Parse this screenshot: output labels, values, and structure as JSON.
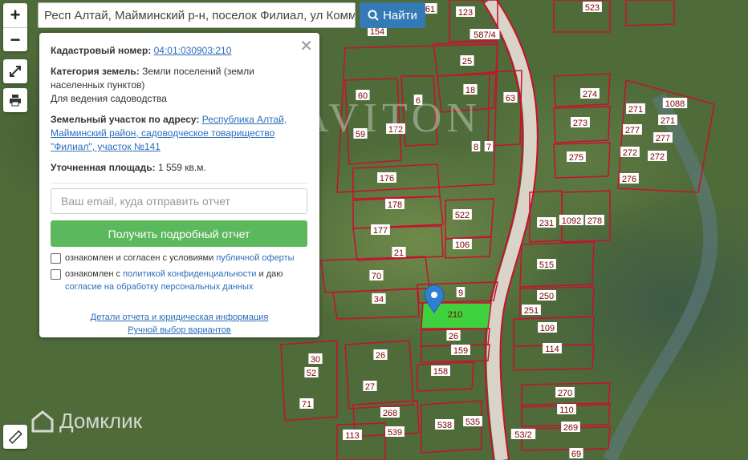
{
  "search": {
    "value": "Респ Алтай, Майминский р-н, поселок Филиал, ул Коммуна",
    "button_label": "Найти",
    "icon": "search-icon"
  },
  "map": {
    "watermark": "GRAVITON",
    "brand": "Домклик",
    "selected_plot": "210",
    "plot_labels": [
      "61",
      "123",
      "523",
      "154",
      "587/4",
      "25",
      "18",
      "60",
      "6",
      "63",
      "274",
      "1088",
      "271",
      "271",
      "273",
      "277",
      "277",
      "172",
      "59",
      "275",
      "272",
      "272",
      "8",
      "7",
      "176",
      "276",
      "522",
      "178",
      "231",
      "1092",
      "278",
      "177",
      "106",
      "21",
      "515",
      "70",
      "9",
      "250",
      "34",
      "210",
      "251",
      "109",
      "26",
      "159",
      "114",
      "30",
      "26",
      "52",
      "158",
      "270",
      "27",
      "71",
      "268",
      "110",
      "538",
      "535",
      "113",
      "539",
      "269",
      "53/2",
      "69"
    ],
    "colors": {
      "plot_border": "#c8102e",
      "selected_fill": "#3ed23e",
      "marker": "#2f7fd2"
    }
  },
  "panel": {
    "cadastral_label": "Кадастровый номер:",
    "cadastral_value": "04:01:030903:210",
    "category_label": "Категория земель:",
    "category_value": "Земли поселений (земли населенных пунктов)",
    "usage": "Для ведения садоводства",
    "address_label": "Земельный участок по адресу:",
    "address_value": "Республика Алтай, Майминский район, садоводческое товарищество \"Филиал\", участок №141",
    "area_label": "Уточненная площадь:",
    "area_value": "1 559 кв.м.",
    "email_placeholder": "Ваш email, куда отправить отчет",
    "report_button": "Получить подробный отчет",
    "check1_text": "ознакомлен и согласен с условиями",
    "check1_link": "публичной оферты",
    "check2_text": "ознакомлен с",
    "check2_link": "политикой конфиденциальности",
    "check2_mid": "и даю",
    "check2_link2": "согласие на обработку персональных данных",
    "details_link": "Детали отчета и юридическая информация",
    "manual_link": "Ручной выбор вариантов"
  }
}
